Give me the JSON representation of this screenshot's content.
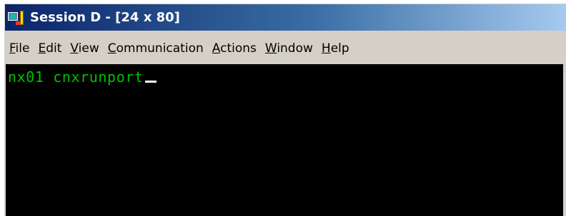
{
  "window": {
    "title": "Session D - [24 x 80]",
    "app_icon": "session-app-icon"
  },
  "menu": {
    "items": [
      {
        "underline": "F",
        "rest": "ile"
      },
      {
        "underline": "E",
        "rest": "dit"
      },
      {
        "underline": "V",
        "rest": "iew"
      },
      {
        "underline": "C",
        "rest": "ommunication"
      },
      {
        "underline": "A",
        "rest": "ctions"
      },
      {
        "underline": "W",
        "rest": "indow"
      },
      {
        "underline": "H",
        "rest": "elp"
      }
    ]
  },
  "terminal": {
    "line1": "nx01 cnxrunport",
    "text_color": "#00c000",
    "background": "#000000",
    "cursor_color": "#ffffff"
  },
  "colors": {
    "titlebar_start": "#0a246a",
    "titlebar_end": "#a6caf0",
    "chrome": "#d4d0c8"
  }
}
